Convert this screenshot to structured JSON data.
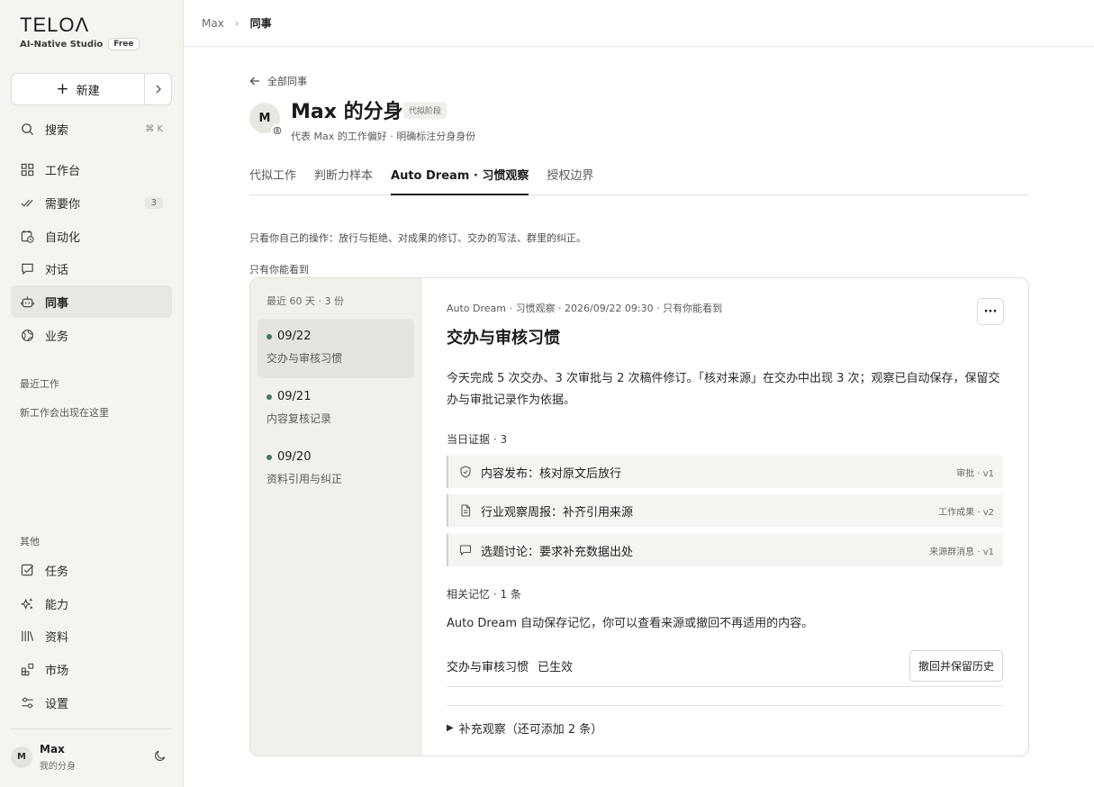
{
  "brand": {
    "logo": "TELOΛ",
    "studio": "AI-Native Studio",
    "plan": "Free"
  },
  "sidebar": {
    "new_label": "新建",
    "search": {
      "label": "搜索",
      "shortcut": "⌘ K"
    },
    "items": [
      {
        "label": "工作台"
      },
      {
        "label": "需要你",
        "badge": "3"
      },
      {
        "label": "自动化"
      },
      {
        "label": "对话"
      },
      {
        "label": "同事"
      },
      {
        "label": "业务"
      }
    ],
    "recent_title": "最近工作",
    "recent_empty": "新工作会出现在这里",
    "other_title": "其他",
    "other_items": [
      {
        "label": "任务"
      },
      {
        "label": "能力"
      },
      {
        "label": "资料"
      },
      {
        "label": "市场"
      },
      {
        "label": "设置"
      }
    ],
    "user": {
      "initial": "M",
      "name": "Max",
      "sub": "我的分身"
    }
  },
  "breadcrumb": {
    "parent": "Max",
    "current": "同事"
  },
  "header": {
    "back_label": "全部同事",
    "avatar_initial": "M",
    "title": "Max 的分身",
    "stage_badge": "代拟阶段",
    "subtitle": "代表 Max 的工作偏好 · 明确标注分身身份"
  },
  "tabs": [
    {
      "label": "代拟工作"
    },
    {
      "label": "判断力样本"
    },
    {
      "label": "Auto Dream · 习惯观察"
    },
    {
      "label": "授权边界"
    }
  ],
  "description": "只看你自己的操作：放行与拒绝、对成果的修订、交办的写法、群里的纠正。",
  "private_label": "只有你能看到",
  "days_panel": {
    "range_label": "最近 60 天 · 3 份",
    "days": [
      {
        "date": "09/22",
        "title": "交办与审核习惯"
      },
      {
        "date": "09/21",
        "title": "内容复核记录"
      },
      {
        "date": "09/20",
        "title": "资料引用与纠正"
      }
    ]
  },
  "detail": {
    "meta": "Auto Dream · 习惯观察 · 2026/09/22 09:30 · 只有你能看到",
    "more": "···",
    "title": "交办与审核习惯",
    "body": "今天完成 5 次交办、3 次审批与 2 次稿件修订。「核对来源」在交办中出现 3 次；观察已自动保存，保留交办与审批记录作为依据。",
    "evidence_label": "当日证据 · 3",
    "evidence": [
      {
        "icon": "shield-check-icon",
        "text": "内容发布：核对原文后放行",
        "tag": "审批 · v1"
      },
      {
        "icon": "document-icon",
        "text": "行业观察周报：补齐引用来源",
        "tag": "工作成果 · v2"
      },
      {
        "icon": "chat-bubble-icon",
        "text": "选题讨论：要求补充数据出处",
        "tag": "来源群消息 · v1"
      }
    ],
    "memory_label": "相关记忆 · 1 条",
    "memory_desc": "Auto Dream 自动保存记忆，你可以查看来源或撤回不再适用的内容。",
    "memory_item": {
      "name": "交办与审核习惯",
      "status": "已生效",
      "action": "撤回并保留历史"
    },
    "supplement": "补充观察（还可添加 2 条）"
  },
  "colors": {
    "accent_dot": "#3f7a5b",
    "sidebar_bg": "#f4f4f1",
    "active_bg": "#e8e7e3"
  }
}
